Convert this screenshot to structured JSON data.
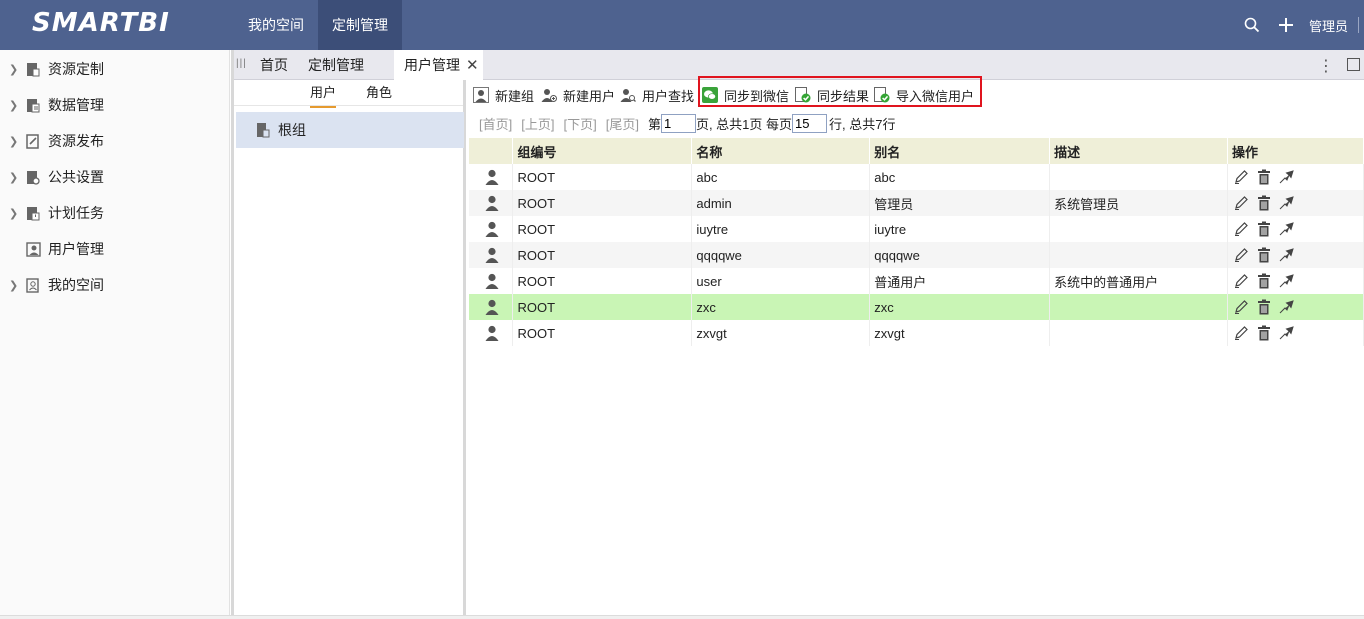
{
  "app": {
    "logo_text": "SMARTBI"
  },
  "topnav": [
    {
      "label": "我的空间"
    },
    {
      "label": "定制管理"
    }
  ],
  "topright": {
    "user": "管理员"
  },
  "sidebar": {
    "items": [
      {
        "label": "资源定制"
      },
      {
        "label": "数据管理"
      },
      {
        "label": "资源发布"
      },
      {
        "label": "公共设置"
      },
      {
        "label": "计划任务"
      },
      {
        "label": "用户管理"
      },
      {
        "label": "我的空间"
      }
    ]
  },
  "tabs": [
    {
      "label": "首页"
    },
    {
      "label": "定制管理"
    },
    {
      "label": "用户管理"
    }
  ],
  "tree": {
    "subtabs": [
      {
        "label": "用户"
      },
      {
        "label": "角色"
      }
    ],
    "root_label": "根组"
  },
  "toolbar": {
    "new_group": "新建组",
    "new_user": "新建用户",
    "find_user": "用户查找",
    "sync_wechat": "同步到微信",
    "sync_result": "同步结果",
    "import_wechat": "导入微信用户"
  },
  "pager": {
    "first": "[首页]",
    "prev": "[上页]",
    "next": "[下页]",
    "last": "[尾页]",
    "page_prefix": "第",
    "page_value": "1",
    "page_suffix": "页,  总共1页 每页",
    "per_page_value": "15",
    "rows_suffix": "行,  总共7行"
  },
  "table": {
    "headers": [
      "",
      "组编号",
      "名称",
      "别名",
      "描述",
      "操作"
    ],
    "rows": [
      {
        "group": "ROOT",
        "name": "abc",
        "alias": "abc",
        "desc": ""
      },
      {
        "group": "ROOT",
        "name": "admin",
        "alias": "管理员",
        "desc": "系统管理员"
      },
      {
        "group": "ROOT",
        "name": "iuytre",
        "alias": "iuytre",
        "desc": ""
      },
      {
        "group": "ROOT",
        "name": "qqqqwe",
        "alias": "qqqqwe",
        "desc": ""
      },
      {
        "group": "ROOT",
        "name": "user",
        "alias": "普通用户",
        "desc": "系统中的普通用户"
      },
      {
        "group": "ROOT",
        "name": "zxc",
        "alias": "zxc",
        "desc": ""
      },
      {
        "group": "ROOT",
        "name": "zxvgt",
        "alias": "zxvgt",
        "desc": ""
      }
    ],
    "selected_row": 5
  },
  "colors": {
    "header_bg": "#4e628f",
    "header_active": "#3c4e78",
    "selection_green": "#c9f5b5",
    "highlight_red": "#e0141e",
    "tab_accent": "#e59a2f"
  }
}
